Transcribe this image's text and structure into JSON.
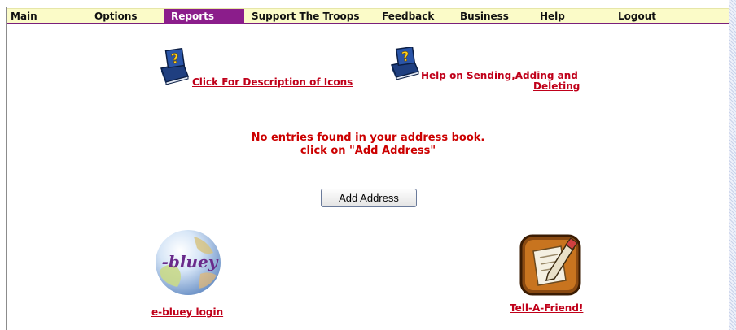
{
  "nav": {
    "items": [
      {
        "label": "Main"
      },
      {
        "label": "Options"
      },
      {
        "label": "Reports"
      },
      {
        "label": "Support The Troops"
      },
      {
        "label": "Feedback"
      },
      {
        "label": "Business"
      },
      {
        "label": "Help"
      },
      {
        "label": "Logout"
      }
    ],
    "active": "Reports"
  },
  "help_links": {
    "icons_description": "Click For Description of Icons",
    "sending_line1": "Help on Sending,Adding and",
    "sending_line2": "Deleting"
  },
  "message": {
    "line1": "No entries found in your address book.",
    "line2": "click on \"Add Address\""
  },
  "add_address_button": "Add Address",
  "ebluey": {
    "logo_text": "-bluey",
    "link": "e-bluey login"
  },
  "tell_a_friend": {
    "link": "Tell-A-Friend!"
  },
  "colors": {
    "nav_bg": "#fbfbc8",
    "nav_active": "#8b1d8b",
    "link_red": "#c0001a",
    "message_red": "#cc0000"
  }
}
